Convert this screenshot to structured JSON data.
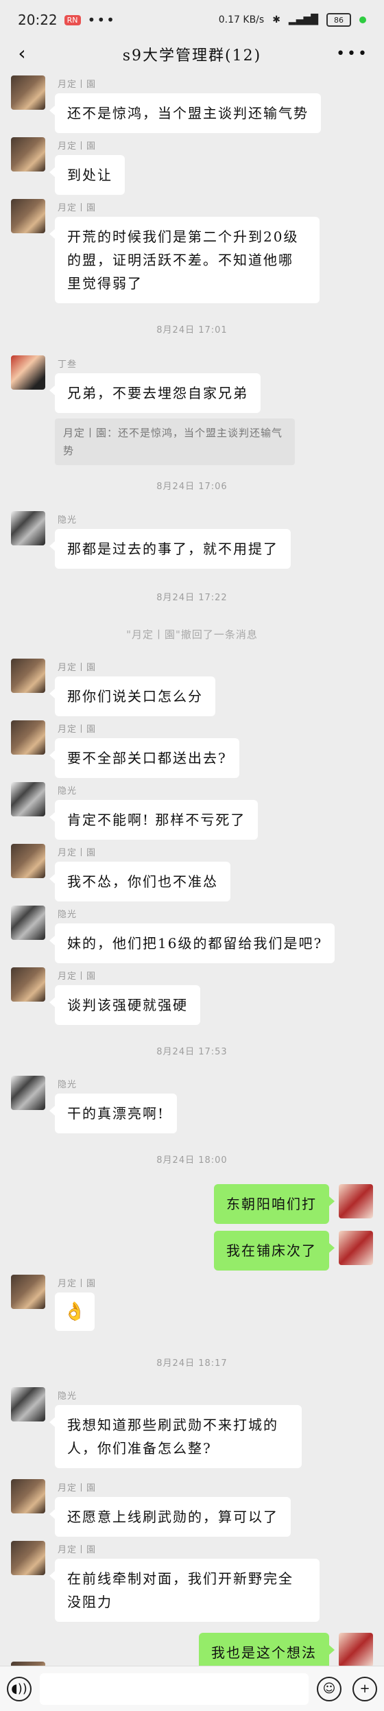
{
  "status": {
    "time": "20:22",
    "app_badge": "RN",
    "dots": "•••",
    "net": "0.17 KB/s",
    "batt": "86"
  },
  "nav": {
    "back": "‹",
    "title": "s9大学管理群(12)",
    "more": "•••"
  },
  "names": {
    "yueding": "月定丨園",
    "dingsan": "丁叁",
    "yinguang": "隐光"
  },
  "messages": {
    "m1": "还不是惊鸿，当个盟主谈判还输气势",
    "m2": "到处让",
    "m3": "开荒的时候我们是第二个升到20级的盟，证明活跃不差。不知道他哪里觉得弱了",
    "t1": "8月24日 17:01",
    "m4": "兄弟，不要去埋怨自家兄弟",
    "q4": "月定丨園：还不是惊鸿，当个盟主谈判还输气势",
    "t2": "8月24日 17:06",
    "m5": "那都是过去的事了，就不用提了",
    "t3": "8月24日 17:22",
    "recall": "\"月定丨園\"撤回了一条消息",
    "m6": "那你们说关口怎么分",
    "m7": "要不全部关口都送出去?",
    "m8": "肯定不能啊! 那样不亏死了",
    "m9": "我不怂，你们也不准怂",
    "m10": "妹的，他们把16级的都留给我们是吧?",
    "m11": "谈判该强硬就强硬",
    "t4": "8月24日 17:53",
    "m12": "干的真漂亮啊!",
    "t5": "8月24日 18:00",
    "m13": "东朝阳咱们打",
    "m14": "我在铺床次了",
    "m15": "👌",
    "t6": "8月24日 18:17",
    "m16": "我想知道那些刷武勋不来打城的人，你们准备怎么整?",
    "m17": "还愿意上线刷武勋的，算可以了",
    "m18": "在前线牵制对面，我们开新野完全没阻力",
    "m19": "我也是这个想法"
  },
  "bottom": {
    "voice_icon": "voice-icon",
    "emoji_icon": "emoji-icon",
    "plus_icon": "plus-icon"
  }
}
